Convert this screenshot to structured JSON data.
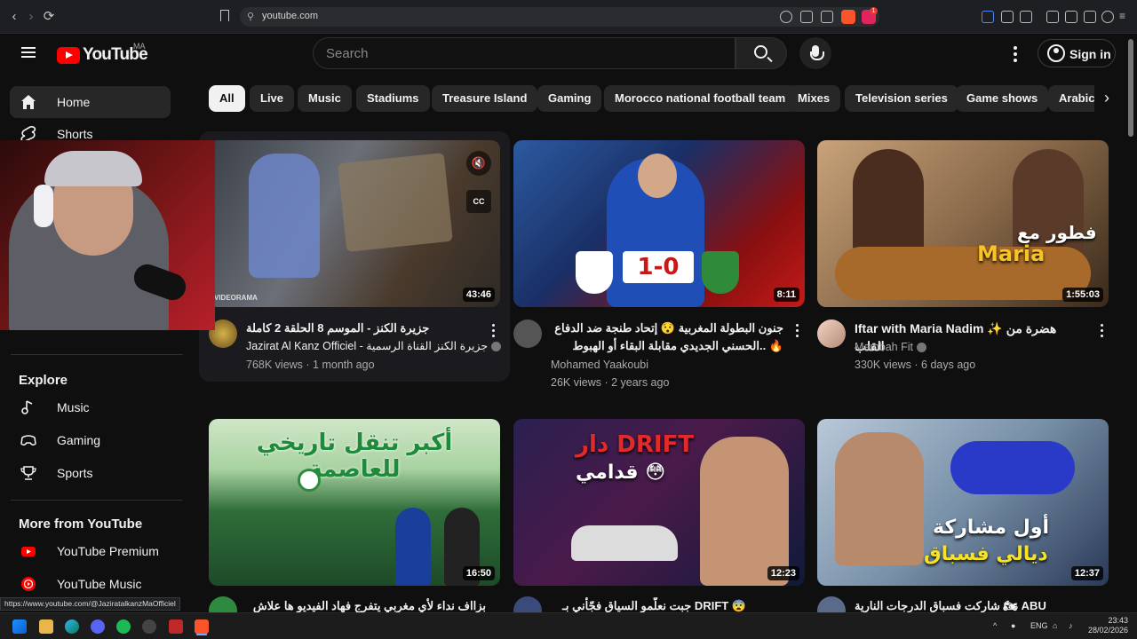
{
  "browser": {
    "url": "youtube.com",
    "status_url": "https://www.youtube.com/@JaziratalkanzMaOfficiel",
    "extension_badge": "1"
  },
  "header": {
    "logo_text": "YouTube",
    "country_code": "MA",
    "search_placeholder": "Search",
    "signin_label": "Sign in"
  },
  "sidebar": {
    "items": [
      {
        "label": "Home",
        "icon": "home-icon"
      },
      {
        "label": "Shorts",
        "icon": "shorts-icon"
      }
    ],
    "explore_heading": "Explore",
    "explore": [
      {
        "label": "Music",
        "icon": "music-note-icon"
      },
      {
        "label": "Gaming",
        "icon": "gamepad-icon"
      },
      {
        "label": "Sports",
        "icon": "trophy-icon"
      }
    ],
    "more_heading": "More from YouTube",
    "more": [
      {
        "label": "YouTube Premium",
        "icon": "youtube-premium-icon"
      },
      {
        "label": "YouTube Music",
        "icon": "youtube-music-icon"
      }
    ]
  },
  "chips": [
    "All",
    "Live",
    "Music",
    "Stadiums",
    "Treasure Island",
    "Gaming",
    "Morocco national football team",
    "Mixes",
    "Television series",
    "Game shows",
    "Arabic I"
  ],
  "videos": [
    {
      "title": "جزيرة الكنز - الموسم 8 الحلقة 2 كاملة",
      "channel": "Jazirat Al Kanz Officiel - جزيرة الكنز القناة الرسمية",
      "meta": "768K views · 1 month ago",
      "duration": "43:46",
      "thumb_watermark": "VIDEORAMA"
    },
    {
      "title": "جنون البطولة المغربية 😯 إتحاد طنجة ضد الدفاع الحسني الجديدي مقابلة البقاء أو الهبوط.. 🔥",
      "channel": "Mohamed Yaakoubi",
      "meta": "26K views · 2 years ago",
      "duration": "8:11",
      "thumb_score": "1-0"
    },
    {
      "title": "Iftar with Maria Nadim ✨ هضرة من القلب",
      "channel": "Mambah Fit",
      "meta": "330K views · 6 days ago",
      "duration": "1:55:03",
      "thumb_text_ar": "فطور مع",
      "thumb_text_en": "Maria"
    },
    {
      "title": "بزااف نداء لأي مغربي يتفرج فهاد الفيديو ها علاش كنحبو",
      "duration": "16:50",
      "thumb_text": "أكبر تنقل تاريخي للعاصمة"
    },
    {
      "title": "جبت نعلّمو السياق فجّأني بـ DRIFT 😨 🔥",
      "duration": "12:23",
      "thumb_text_top": "دار DRIFT",
      "thumb_text_bottom": "قدامي 😳"
    },
    {
      "title": "شاركت فسباق الدرجات النارية 🏍 ABU DHABI 🇦🇪",
      "duration": "12:37",
      "thumb_text_top": "أول مشاركة",
      "thumb_text_bottom": "ديالي فسباق"
    }
  ],
  "taskbar": {
    "lang": "ENG",
    "time": "23:43",
    "date": "28/02/2026"
  },
  "colors": {
    "brand": "#ff0000",
    "bg": "#0f0f0f",
    "chip": "#272727"
  }
}
